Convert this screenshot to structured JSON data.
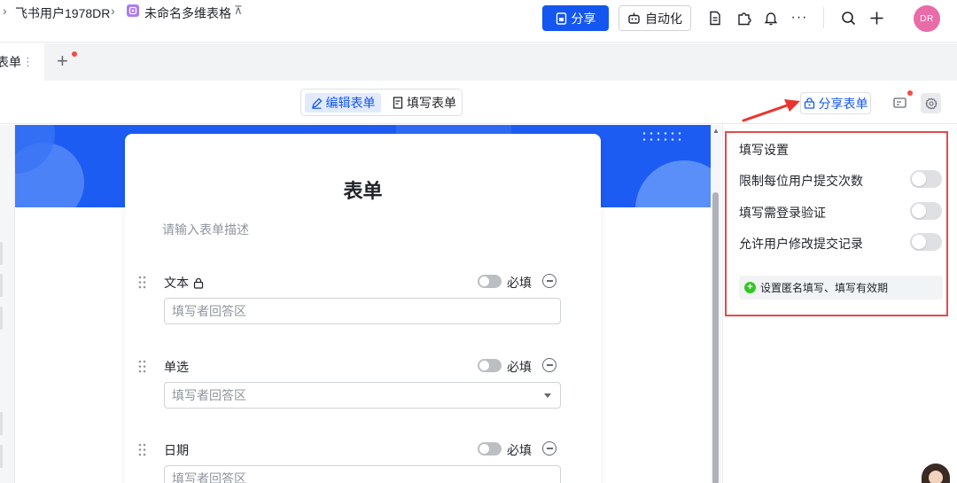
{
  "breadcrumb": {
    "workspace": "飞书用户1978DR",
    "doc_title": "未命名多维表格"
  },
  "header": {
    "share_label": "分享",
    "automation_label": "自动化",
    "avatar_initials": "DR"
  },
  "tabs": {
    "active_label": "表单"
  },
  "toolbar": {
    "edit_form_label": "编辑表单",
    "fill_form_label": "填写表单",
    "share_form_label": "分享表单"
  },
  "form": {
    "title": "表单",
    "description_placeholder": "请输入表单描述",
    "required_label": "必填",
    "fields": [
      {
        "label": "文本",
        "placeholder": "填写者回答区",
        "type": "text"
      },
      {
        "label": "单选",
        "placeholder": "填写者回答区",
        "type": "select"
      },
      {
        "label": "日期",
        "placeholder": "填写者回答区",
        "type": "date"
      }
    ]
  },
  "settings_panel": {
    "title": "填写设置",
    "options": [
      {
        "label": "限制每位用户提交次数",
        "enabled": false
      },
      {
        "label": "填写需登录验证",
        "enabled": false
      },
      {
        "label": "允许用户修改提交记录",
        "enabled": false
      }
    ],
    "anonymous_link": "设置匿名填写、填写有效期"
  },
  "colors": {
    "primary": "#1456f0",
    "banner": "#1c5cf2",
    "highlight_border": "#e44a4a",
    "avatar": "#e96ba8"
  }
}
